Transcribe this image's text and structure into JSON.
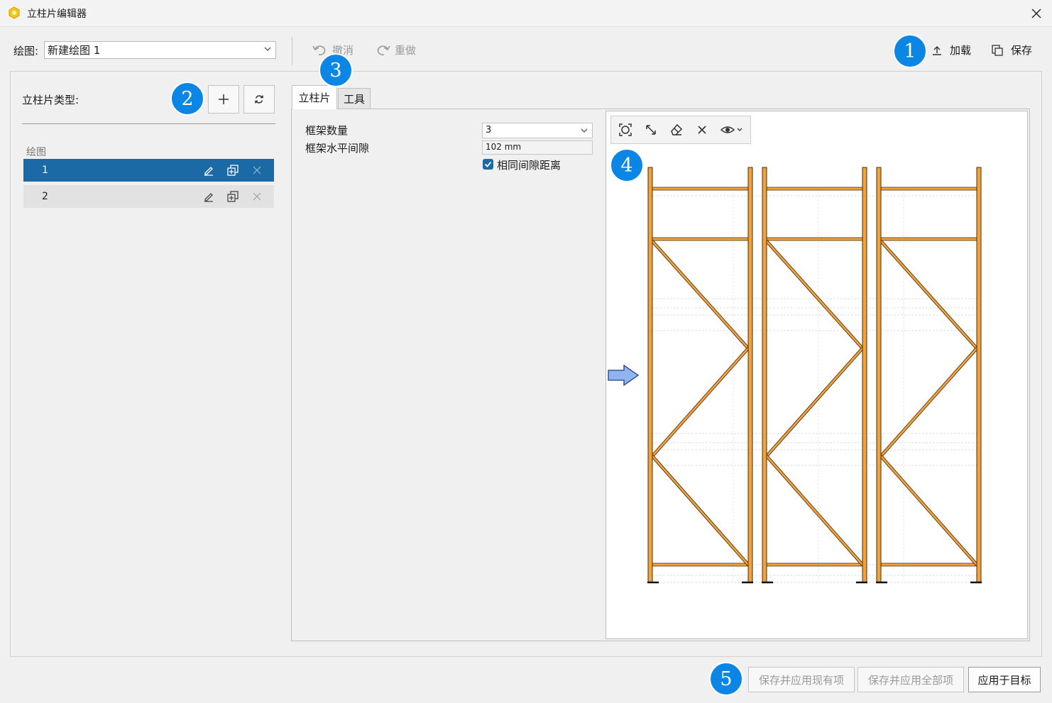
{
  "window": {
    "title": "立柱片编辑器"
  },
  "toolbar": {
    "drawing_label": "绘图:",
    "drawing_value": "新建绘图 1",
    "undo_label": "撤消",
    "redo_label": "重做",
    "load_label": "加载",
    "save_label": "保存"
  },
  "left_panel": {
    "title": "立柱片类型:",
    "group_label": "绘图",
    "items": [
      {
        "label": "1",
        "selected": true
      },
      {
        "label": "2",
        "selected": false
      }
    ]
  },
  "tabs": [
    {
      "label": "立柱片",
      "active": true
    },
    {
      "label": "工具",
      "active": false
    }
  ],
  "properties": {
    "frame_count_label": "框架数量",
    "frame_count_value": "3",
    "frame_gap_label": "框架水平间隙",
    "frame_gap_value": "102 mm",
    "same_gap_label": "相同间隙距离",
    "same_gap_checked": true
  },
  "canvas": {
    "toolbar_icons": [
      "zoom-fit-icon",
      "measure-icon",
      "eraser-icon",
      "delete-icon",
      "visibility-icon"
    ],
    "frame_color": "#f0a23c",
    "frame_outline_color": "#4a2f10"
  },
  "footer": {
    "save_apply_existing": "保存并应用现有项",
    "save_apply_all": "保存并应用全部项",
    "apply_to_target": "应用于目标"
  },
  "markers": [
    "1",
    "2",
    "3",
    "4",
    "5"
  ],
  "colors": {
    "accent": "#1b6aa6",
    "marker": "#0b86e4"
  }
}
